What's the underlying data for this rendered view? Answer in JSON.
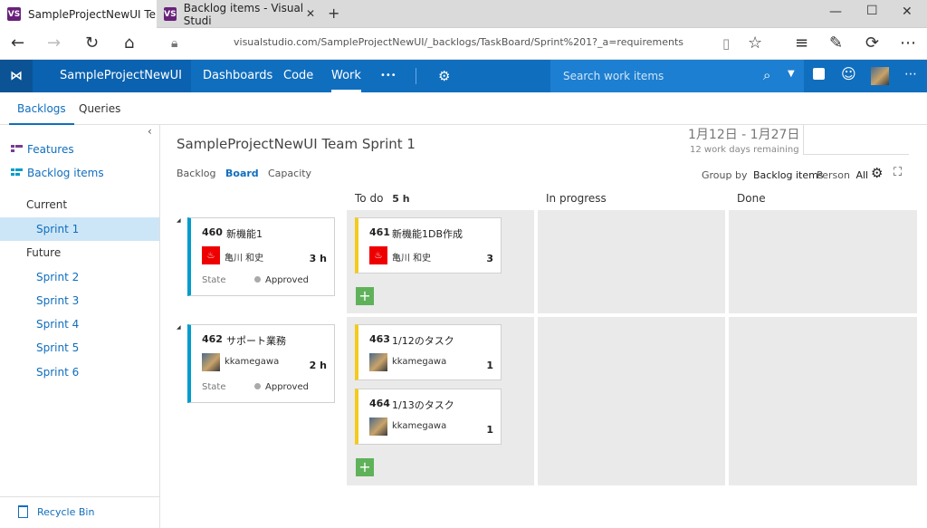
{
  "browser": {
    "tabs": [
      {
        "label": "SampleProjectNewUI Te"
      },
      {
        "label": "Backlog items - Visual Studi"
      }
    ],
    "address": "visualstudio.com/SampleProjectNewUI/_backlogs/TaskBoard/Sprint%201?_a=requirements"
  },
  "header": {
    "project": "SampleProjectNewUI",
    "nav": [
      "Dashboards",
      "Code",
      "Work",
      "•••"
    ],
    "search_placeholder": "Search work items"
  },
  "subtabs": [
    "Backlogs",
    "Queries"
  ],
  "sidebar": {
    "links": [
      "Features",
      "Backlog items"
    ],
    "current_label": "Current",
    "current_sprint": "Sprint 1",
    "future_label": "Future",
    "future_sprints": [
      "Sprint 2",
      "Sprint 3",
      "Sprint 4",
      "Sprint 5",
      "Sprint 6"
    ],
    "recycle": "Recycle Bin"
  },
  "main": {
    "title": "SampleProjectNewUI Team Sprint 1",
    "dates": "1月12日 - 1月27日",
    "remaining": "12 work days remaining",
    "pivots": [
      "Backlog",
      "Board",
      "Capacity"
    ],
    "group_by_label": "Group by",
    "group_by_value": "Backlog items",
    "person_label": "Person",
    "person_value": "All",
    "columns": {
      "todo": "To do",
      "todo_hours": "5 h",
      "inprogress": "In progress",
      "done": "Done"
    }
  },
  "board": {
    "pbis": [
      {
        "id": "460",
        "title": "新機能1",
        "assignee": "亀川 和史",
        "hours": "3 h",
        "state_label": "State",
        "state": "Approved"
      },
      {
        "id": "462",
        "title": "サポート業務",
        "assignee": "kkamegawa",
        "hours": "2 h",
        "state_label": "State",
        "state": "Approved"
      }
    ],
    "tasks": [
      {
        "id": "461",
        "title": "新機能1DB作成",
        "assignee": "亀川 和史",
        "remaining": "3"
      },
      {
        "id": "463",
        "title": "1/12のタスク",
        "assignee": "kkamegawa",
        "remaining": "1"
      },
      {
        "id": "464",
        "title": "1/13のタスク",
        "assignee": "kkamegawa",
        "remaining": "1"
      }
    ]
  }
}
